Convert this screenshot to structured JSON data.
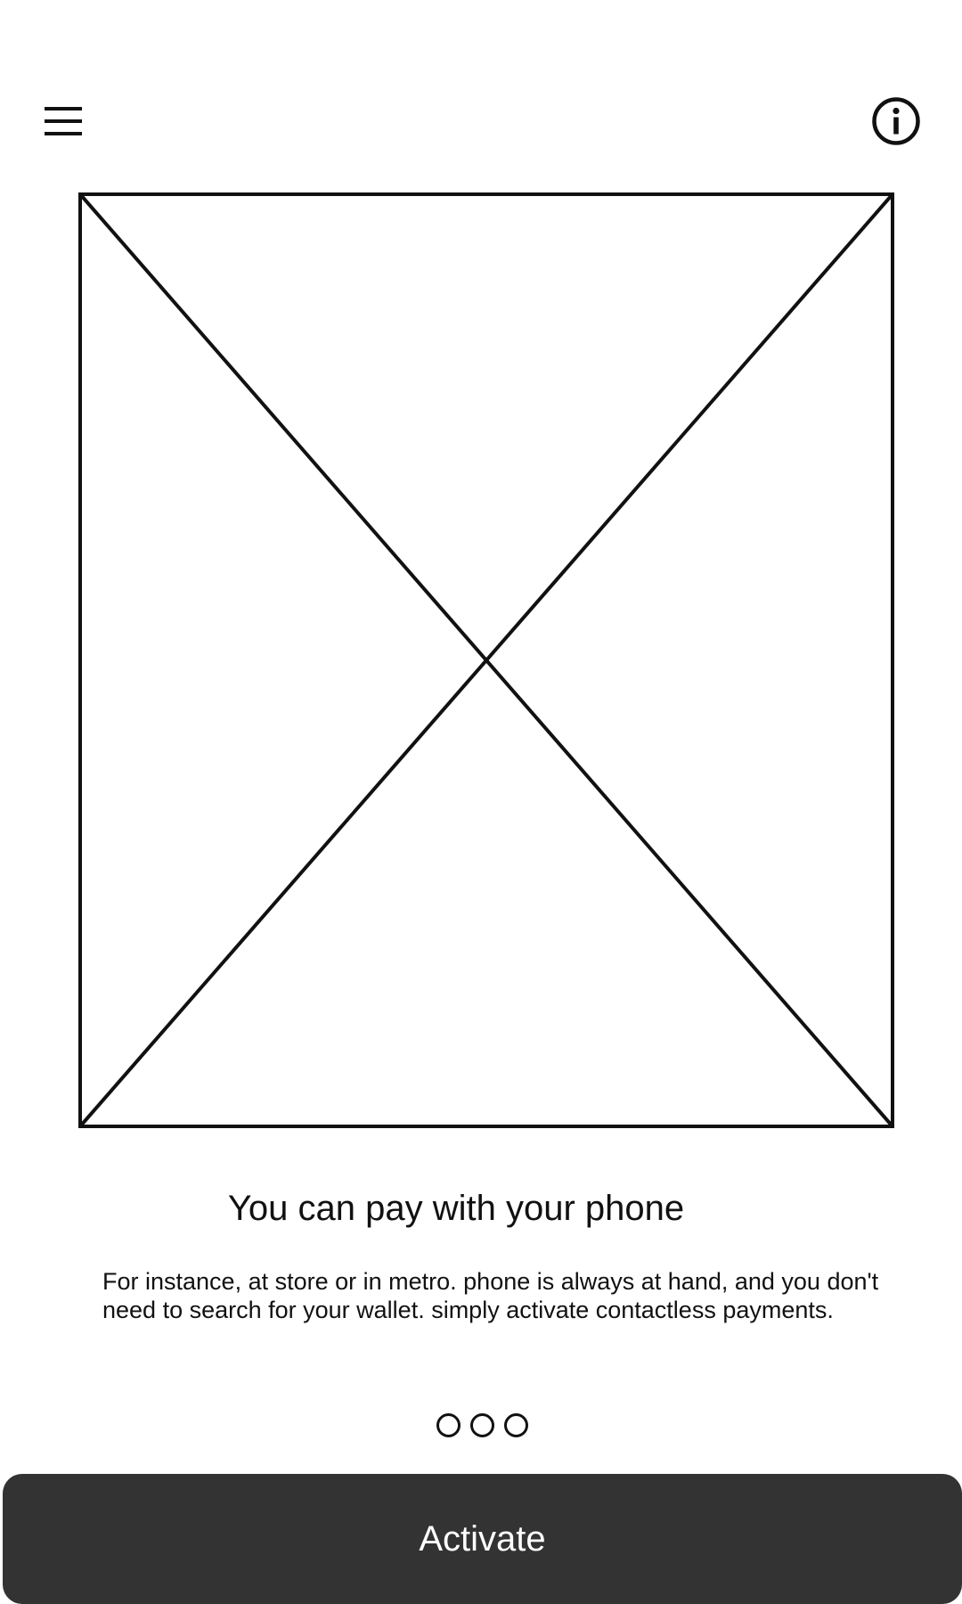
{
  "header": {
    "menu_icon": "hamburger-menu-icon",
    "info_icon": "info-circle-icon"
  },
  "hero": {
    "image": "placeholder-image"
  },
  "content": {
    "title": "You can pay with your phone",
    "description": "For instance, at store or in metro. phone is always at hand, and you don't need to search for your wallet. simply activate contactless payments."
  },
  "pager": {
    "total_pages": 3
  },
  "actions": {
    "activate_label": "Activate"
  },
  "colors": {
    "button_background": "#333333",
    "button_text": "#ffffff",
    "foreground": "#111111",
    "background": "#ffffff"
  }
}
